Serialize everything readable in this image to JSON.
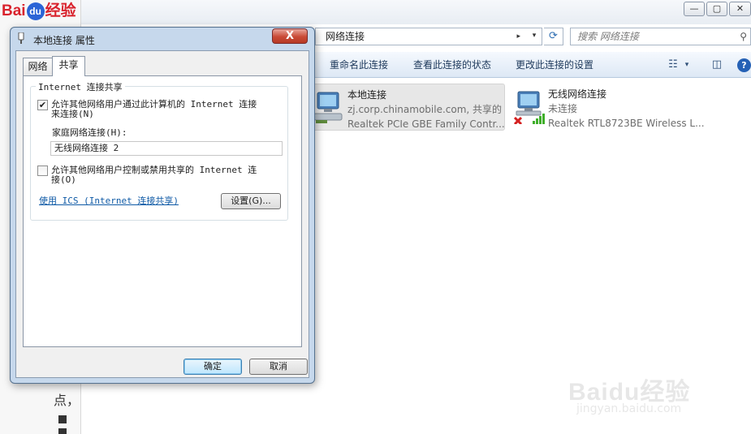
{
  "background": {
    "logo_left": "Bai",
    "logo_du": "du",
    "logo_right": "经验",
    "side_text": "点，"
  },
  "explorer": {
    "window_buttons": {
      "minimize": "—",
      "maximize": "▢",
      "close": "✕"
    },
    "address": {
      "path": "网络连接",
      "arrow": "▸",
      "dropdown": "▾"
    },
    "search": {
      "placeholder": "搜索 网络连接"
    },
    "toolbar": {
      "rename": "重命名此连接",
      "status": "查看此连接的状态",
      "change_settings": "更改此连接的设置"
    },
    "connections": [
      {
        "name": "本地连接",
        "line2": "zj.corp.chinamobile.com, 共享的",
        "line3": "Realtek PCIe GBE Family Contr..."
      },
      {
        "name": "无线网络连接",
        "line2": "未连接",
        "line3": "Realtek RTL8723BE Wireless L..."
      }
    ]
  },
  "dialog": {
    "title": "本地连接 属性",
    "close_label": "X",
    "tabs": [
      {
        "label": "网络",
        "active": false
      },
      {
        "label": "共享",
        "active": true
      }
    ],
    "group_title": "Internet 连接共享",
    "option1": {
      "checked": true,
      "line1": "允许其他网络用户通过此计算机的 Internet 连接",
      "line2": "来连接(N)"
    },
    "home_label": "家庭网络连接(H):",
    "home_value": "无线网络连接 2",
    "option2": {
      "checked": false,
      "line1": "允许其他网络用户控制或禁用共享的 Internet 连",
      "line2": "接(O)"
    },
    "ics_link": "使用 ICS (Internet 连接共享)",
    "settings_button": "设置(G)...",
    "ok_button": "确定",
    "cancel_button": "取消",
    "check_mark": "✔"
  },
  "watermark": {
    "text_left": "Bai",
    "text_du": "du",
    "text_right": "经验",
    "url": "jingyan.baidu.com"
  }
}
